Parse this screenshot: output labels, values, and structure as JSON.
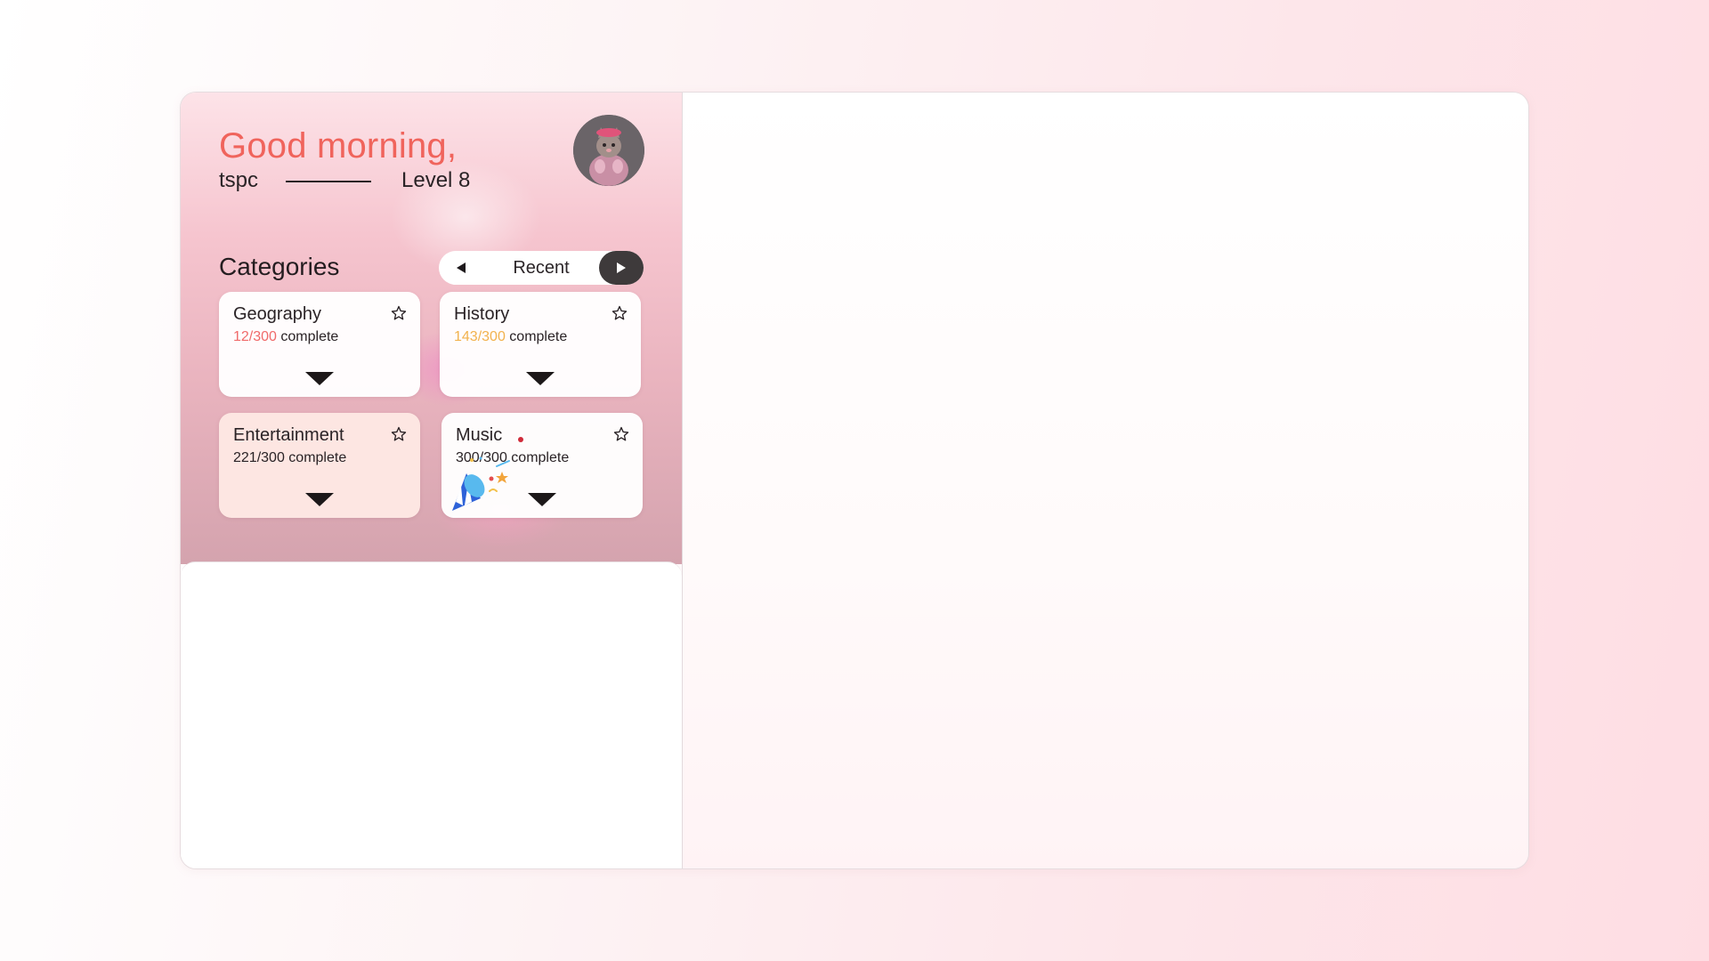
{
  "header": {
    "greeting": "Good morning,",
    "username": "tspc",
    "level": "Level 8",
    "avatar_icon": "cat-avatar-icon"
  },
  "categories": {
    "title": "Categories",
    "sort": {
      "prev_icon": "triangle-left-icon",
      "label": "Recent",
      "next_icon": "triangle-right-icon"
    },
    "items": [
      {
        "name": "Geography",
        "completed": "12/300",
        "suffix": " complete",
        "progress_color": "#f06a6a"
      },
      {
        "name": "History",
        "completed": "143/300",
        "suffix": " complete",
        "progress_color": "#f2b24e"
      },
      {
        "name": "Entertainment",
        "completed": "221/300",
        "suffix": " complete",
        "progress_color": "#2a2326"
      },
      {
        "name": "Music",
        "completed": "300/300",
        "suffix": " complete",
        "progress_color": "#2a2326"
      }
    ]
  },
  "colors": {
    "accent": "#f0645c",
    "pill_dark": "#3e3a3b"
  }
}
